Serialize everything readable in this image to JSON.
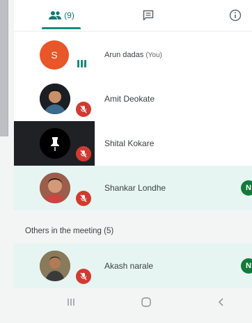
{
  "tabs": {
    "people_count": "(9)",
    "chat_icon": "chat-bubble-icon",
    "info_icon": "info-icon"
  },
  "participants": [
    {
      "name": "Arun dadas",
      "suffix": "(You)",
      "initial": "S",
      "avatar_color": "#e8562a",
      "status": "speaking"
    },
    {
      "name": "Amit Deokate",
      "status": "muted"
    },
    {
      "name": "Shital Kokare",
      "status": "muted",
      "pinned": true
    },
    {
      "name": "Shankar Londhe",
      "status": "muted",
      "badge": "N"
    }
  ],
  "others": {
    "title": "Others in the meeting (5)",
    "items": [
      {
        "name": "Akash narale",
        "status": "muted",
        "badge": "N"
      }
    ]
  },
  "colors": {
    "accent": "#1a8a7b",
    "mute": "#d33a2f",
    "highlight": "#e6f5f2",
    "badge": "#137a3a"
  },
  "bottom_nav": {
    "recents": "recents-icon",
    "home": "home-icon",
    "back": "back-icon"
  }
}
